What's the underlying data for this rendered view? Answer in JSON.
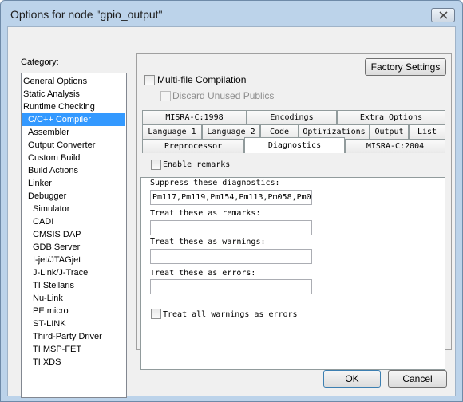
{
  "window": {
    "title": "Options for node \"gpio_output\"",
    "close_icon": "close-icon"
  },
  "category": {
    "label": "Category:",
    "items": [
      {
        "label": "General Options",
        "indent": 0
      },
      {
        "label": "Static Analysis",
        "indent": 0
      },
      {
        "label": "Runtime Checking",
        "indent": 0
      },
      {
        "label": "C/C++ Compiler",
        "indent": 1,
        "selected": true
      },
      {
        "label": "Assembler",
        "indent": 1
      },
      {
        "label": "Output Converter",
        "indent": 1
      },
      {
        "label": "Custom Build",
        "indent": 1
      },
      {
        "label": "Build Actions",
        "indent": 1
      },
      {
        "label": "Linker",
        "indent": 1
      },
      {
        "label": "Debugger",
        "indent": 1
      },
      {
        "label": "Simulator",
        "indent": 2
      },
      {
        "label": "CADI",
        "indent": 2
      },
      {
        "label": "CMSIS DAP",
        "indent": 2
      },
      {
        "label": "GDB Server",
        "indent": 2
      },
      {
        "label": "I-jet/JTAGjet",
        "indent": 2
      },
      {
        "label": "J-Link/J-Trace",
        "indent": 2
      },
      {
        "label": "TI Stellaris",
        "indent": 2
      },
      {
        "label": "Nu-Link",
        "indent": 2
      },
      {
        "label": "PE micro",
        "indent": 2
      },
      {
        "label": "ST-LINK",
        "indent": 2
      },
      {
        "label": "Third-Party Driver",
        "indent": 2
      },
      {
        "label": "TI MSP-FET",
        "indent": 2
      },
      {
        "label": "TI XDS",
        "indent": 2
      }
    ]
  },
  "factory_settings_label": "Factory Settings",
  "multifile": {
    "label": "Multi-file Compilation",
    "checked": false
  },
  "discard": {
    "label": "Discard Unused Publics",
    "checked": false,
    "disabled": true
  },
  "tabs": {
    "row1": [
      "MISRA-C:1998",
      "Encodings",
      "Extra Options"
    ],
    "row2": [
      "Language 1",
      "Language 2",
      "Code",
      "Optimizations",
      "Output",
      "List"
    ],
    "row3": [
      "Preprocessor",
      "Diagnostics",
      "MISRA-C:2004"
    ],
    "active": "Diagnostics"
  },
  "diagnostics": {
    "enable_remarks_label": "Enable remarks",
    "suppress_label": "Suppress these diagnostics:",
    "suppress_value": "Pm117,Pm119,Pm154,Pm113,Pm058,Pm0",
    "remarks_label": "Treat these as remarks:",
    "remarks_value": "",
    "warnings_label": "Treat these as warnings:",
    "warnings_value": "",
    "errors_label": "Treat these as errors:",
    "errors_value": "",
    "all_warnings_label": "Treat all warnings as errors"
  },
  "ok_label": "OK",
  "cancel_label": "Cancel"
}
